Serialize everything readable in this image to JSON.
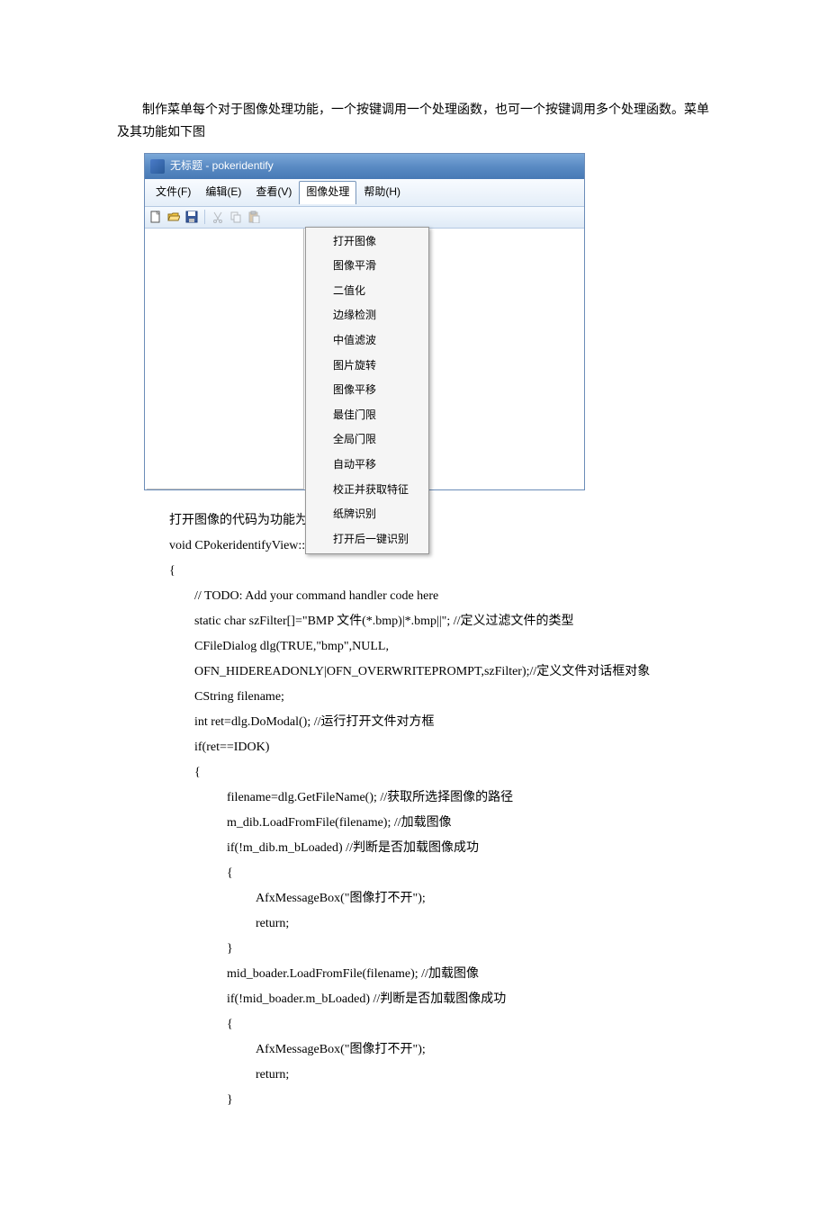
{
  "intro": "制作菜单每个对于图像处理功能，一个按键调用一个处理函数，也可一个按键调用多个处理函数。菜单及其功能如下图",
  "window": {
    "title": "无标题 - pokeridentify",
    "menus": [
      "文件(F)",
      "编辑(E)",
      "查看(V)",
      "图像处理",
      "帮助(H)"
    ],
    "dropdown": [
      "打开图像",
      "图像平滑",
      "二值化",
      "边缘检测",
      "中值滤波",
      "图片旋转",
      "图像平移",
      "最佳门限",
      "全局门限",
      "自动平移",
      "校正并获取特征",
      "纸牌识别",
      "打开后一键识别"
    ]
  },
  "code": {
    "l01": "打开图像的代码为功能为大开所处理图像：",
    "l02": "void CPokeridentifyView::OnOpenimage()",
    "l03": "{",
    "l04": "// TODO: Add your command handler code here",
    "l05": "static char szFilter[]=\"BMP 文件(*.bmp)|*.bmp||\";    //定义过滤文件的类型",
    "l06": "CFileDialog dlg(TRUE,\"bmp\",NULL,",
    "l07": "OFN_HIDEREADONLY|OFN_OVERWRITEPROMPT,szFilter);//定义文件对话框对象",
    "l08": "CString filename;",
    "l09": " int ret=dlg.DoModal();    //运行打开文件对方框",
    "l10": "if(ret==IDOK)",
    "l11": "{",
    "l12": "filename=dlg.GetFileName();        //获取所选择图像的路径",
    "l13": "m_dib.LoadFromFile(filename);      //加载图像",
    "l14": "if(!m_dib.m_bLoaded)                    //判断是否加载图像成功",
    "l15": "{",
    "l16": "AfxMessageBox(\"图像打不开\");",
    "l17": "return;",
    "l18": "}",
    "l19": "mid_boader.LoadFromFile(filename);      //加载图像",
    "l20": "if(!mid_boader.m_bLoaded)                    //判断是否加载图像成功",
    "l21": "{",
    "l22": "AfxMessageBox(\"图像打不开\");",
    "l23": "return;",
    "l24": "}"
  }
}
